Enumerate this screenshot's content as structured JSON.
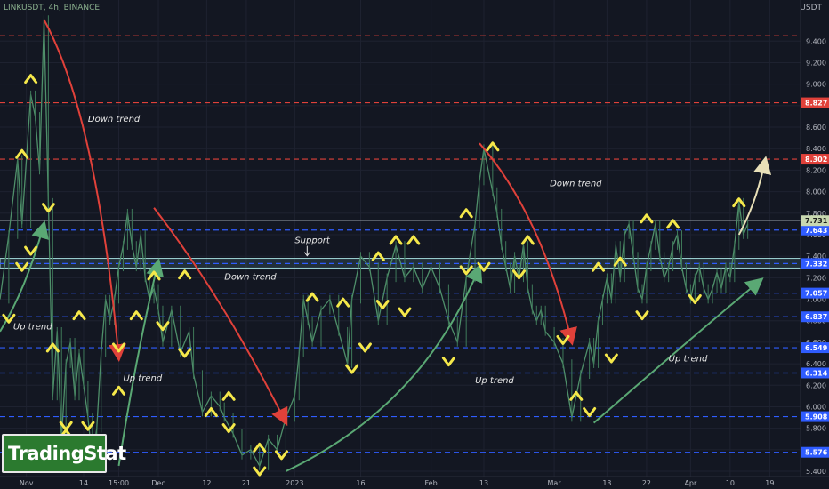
{
  "header": {
    "symbol_title": "LINKUSDT, 4h, BINANCE",
    "currency": "USDT"
  },
  "logo": {
    "text": "TradingStat"
  },
  "chart_data": {
    "type": "line",
    "title": "LINKUSDT, 4h, BINANCE",
    "ylim": [
      5.4,
      9.7
    ],
    "y_ticks": [
      9.4,
      9.2,
      9.0,
      8.8,
      8.6,
      8.4,
      8.2,
      8.0,
      7.8,
      7.6,
      7.4,
      7.2,
      7.0,
      6.8,
      6.6,
      6.4,
      6.2,
      6.0,
      5.8,
      5.6,
      5.4
    ],
    "y_tick_labels": [
      "9.400",
      "9.200",
      "9.000",
      "8.800",
      "8.600",
      "8.400",
      "8.200",
      "8.000",
      "7.800",
      "7.600",
      "7.400",
      "7.200",
      "7.000",
      "6.800",
      "6.600",
      "6.400",
      "6.200",
      "6.000",
      "5.800",
      "5.600",
      "5.400"
    ],
    "x_ticks": [
      {
        "label": "Nov",
        "day": 0
      },
      {
        "label": "14",
        "day": 13
      },
      {
        "label": "15:00",
        "day": 21
      },
      {
        "label": "Dec",
        "day": 30
      },
      {
        "label": "12",
        "day": 41
      },
      {
        "label": "21",
        "day": 50
      },
      {
        "label": "2023",
        "day": 61
      },
      {
        "label": "16",
        "day": 76
      },
      {
        "label": "Feb",
        "day": 92
      },
      {
        "label": "13",
        "day": 104
      },
      {
        "label": "Mar",
        "day": 120
      },
      {
        "label": "13",
        "day": 132
      },
      {
        "label": "22",
        "day": 141
      },
      {
        "label": "Apr",
        "day": 151
      },
      {
        "label": "10",
        "day": 160
      },
      {
        "label": "19",
        "day": 169
      }
    ],
    "xlim": [
      -6,
      176
    ],
    "price_series": {
      "name": "LINKUSDT",
      "color": "#4f8f6a",
      "days": [
        -6,
        -4,
        -2,
        -1,
        1,
        2,
        3,
        4,
        5,
        6,
        7,
        8,
        9,
        10,
        11,
        12,
        13,
        14,
        15,
        16,
        17,
        18,
        19,
        20,
        21,
        22,
        23,
        24,
        25,
        26,
        27,
        28,
        29,
        30,
        31,
        33,
        35,
        37,
        38,
        40,
        42,
        44,
        45,
        47,
        49,
        51,
        53,
        55,
        57,
        59,
        61,
        62,
        63,
        64,
        65,
        67,
        69,
        71,
        73,
        74,
        76,
        78,
        80,
        82,
        84,
        86,
        88,
        90,
        92,
        94,
        96,
        98,
        100,
        102,
        103,
        104,
        106,
        107,
        108,
        109,
        110,
        111,
        112,
        113,
        114,
        115,
        116,
        117,
        118,
        120,
        122,
        124,
        126,
        128,
        129,
        130,
        131,
        132,
        133,
        134,
        135,
        136,
        137,
        138,
        139,
        140,
        141,
        142,
        143,
        144,
        145,
        146,
        147,
        148,
        149,
        150,
        151,
        152,
        153,
        154,
        155,
        156,
        157,
        158,
        159,
        160,
        161,
        162,
        163,
        164
      ],
      "values": [
        7.0,
        7.6,
        8.3,
        7.7,
        8.9,
        8.7,
        8.2,
        9.6,
        7.9,
        6.1,
        6.7,
        5.7,
        6.4,
        6.6,
        6.1,
        6.5,
        6.2,
        5.9,
        5.5,
        5.8,
        6.5,
        7.0,
        6.8,
        7.0,
        7.3,
        7.5,
        7.8,
        7.5,
        7.3,
        7.6,
        7.2,
        7.0,
        7.1,
        6.9,
        6.6,
        6.9,
        6.5,
        6.7,
        6.3,
        5.95,
        6.1,
        6.0,
        5.9,
        5.75,
        5.55,
        5.6,
        5.45,
        5.7,
        5.6,
        5.9,
        6.1,
        6.5,
        7.0,
        6.8,
        6.6,
        6.9,
        7.0,
        6.7,
        6.4,
        7.0,
        7.4,
        7.3,
        6.8,
        7.2,
        7.5,
        7.2,
        7.3,
        7.1,
        7.3,
        7.1,
        6.8,
        6.6,
        7.2,
        7.7,
        8.1,
        8.4,
        8.0,
        7.8,
        7.5,
        7.3,
        7.1,
        7.4,
        7.2,
        7.5,
        7.1,
        6.9,
        6.8,
        6.9,
        6.7,
        6.6,
        6.4,
        5.9,
        6.3,
        6.6,
        6.4,
        6.8,
        7.0,
        7.2,
        7.0,
        7.5,
        7.2,
        7.6,
        7.7,
        7.4,
        7.1,
        7.0,
        7.3,
        7.5,
        7.7,
        7.4,
        7.2,
        7.3,
        7.5,
        7.6,
        7.3,
        7.1,
        7.0,
        7.2,
        7.3,
        7.1,
        7.0,
        7.1,
        7.25,
        7.1,
        7.3,
        7.2,
        7.5,
        7.9,
        7.6,
        7.7
      ]
    },
    "horizontal_levels": [
      {
        "value": 9.45,
        "style": "dashed",
        "color": "#e0413a",
        "label": ""
      },
      {
        "value": 8.827,
        "style": "dashed",
        "color": "#e0413a",
        "label": "8.827"
      },
      {
        "value": 8.302,
        "style": "dashed",
        "color": "#e0413a",
        "label": "8.302"
      },
      {
        "value": 7.643,
        "style": "dashed",
        "color": "#2f5cff",
        "label": "7.643"
      },
      {
        "value": 7.332,
        "style": "dashed",
        "color": "#2f5cff",
        "label": "7.332"
      },
      {
        "value": 7.057,
        "style": "dashed",
        "color": "#2f5cff",
        "label": "7.057"
      },
      {
        "value": 6.837,
        "style": "dashed",
        "color": "#2f5cff",
        "label": "6.837"
      },
      {
        "value": 6.549,
        "style": "dashed",
        "color": "#2f5cff",
        "label": "6.549"
      },
      {
        "value": 6.314,
        "style": "dashed",
        "color": "#2f5cff",
        "label": "6.314"
      },
      {
        "value": 5.908,
        "style": "dashed",
        "color": "#2f5cff",
        "label": "5.908"
      },
      {
        "value": 5.576,
        "style": "dashed",
        "color": "#2f5cff",
        "label": "5.576"
      }
    ],
    "current_price": {
      "value": 7.73,
      "label": "7.731"
    },
    "support_zone": {
      "top": 7.38,
      "bottom": 7.29
    },
    "annotations": [
      {
        "text": "Down trend",
        "day": 14,
        "value": 8.65
      },
      {
        "text": "Support",
        "day": 61,
        "value": 7.52
      },
      {
        "text": "Down trend",
        "day": 45,
        "value": 7.18
      },
      {
        "text": "Up trend",
        "day": -3,
        "value": 6.72
      },
      {
        "text": "Up trend",
        "day": 22,
        "value": 6.24
      },
      {
        "text": "Down trend",
        "day": 119,
        "value": 8.05
      },
      {
        "text": "Up trend",
        "day": 146,
        "value": 6.42
      },
      {
        "text": "Up trend",
        "day": 102,
        "value": 6.22
      }
    ],
    "trend_arrows": [
      {
        "color": "#e0413a",
        "points": [
          [
            4,
            9.6
          ],
          [
            16,
            8.7
          ],
          [
            21,
            6.45
          ]
        ]
      },
      {
        "color": "#e0413a",
        "points": [
          [
            29,
            7.85
          ],
          [
            45,
            7.0
          ],
          [
            59,
            5.85
          ]
        ]
      },
      {
        "color": "#e0413a",
        "points": [
          [
            103,
            8.45
          ],
          [
            117,
            7.8
          ],
          [
            124,
            6.6
          ]
        ]
      },
      {
        "color": "#5aa874",
        "points": [
          [
            -6,
            6.7
          ],
          [
            0,
            7.1
          ],
          [
            4,
            7.7
          ]
        ]
      },
      {
        "color": "#5aa874",
        "points": [
          [
            21,
            5.45
          ],
          [
            25,
            6.5
          ],
          [
            30,
            7.35
          ]
        ]
      },
      {
        "color": "#5aa874",
        "points": [
          [
            59,
            5.4
          ],
          [
            90,
            6.0
          ],
          [
            103,
            7.3
          ]
        ]
      },
      {
        "color": "#5aa874",
        "points": [
          [
            129,
            5.85
          ],
          [
            150,
            6.6
          ],
          [
            167,
            7.18
          ]
        ]
      },
      {
        "color": "#e8e0b8",
        "points": [
          [
            162,
            7.6
          ],
          [
            166,
            7.9
          ],
          [
            168,
            8.3
          ]
        ]
      }
    ],
    "up_markers": [
      [
        -1,
        8.35
      ],
      [
        1,
        9.05
      ],
      [
        6,
        6.55
      ],
      [
        9,
        5.75
      ],
      [
        12,
        6.85
      ],
      [
        21,
        6.15
      ],
      [
        25,
        6.85
      ],
      [
        29,
        7.22
      ],
      [
        36,
        7.23
      ],
      [
        42,
        5.95
      ],
      [
        46,
        6.1
      ],
      [
        53,
        5.62
      ],
      [
        65,
        7.02
      ],
      [
        72,
        6.97
      ],
      [
        80,
        7.4
      ],
      [
        84,
        7.55
      ],
      [
        88,
        7.55
      ],
      [
        100,
        7.8
      ],
      [
        106,
        8.42
      ],
      [
        114,
        7.55
      ],
      [
        125,
        6.1
      ],
      [
        130,
        7.3
      ],
      [
        135,
        7.35
      ],
      [
        141,
        7.75
      ],
      [
        147,
        7.7
      ],
      [
        162,
        7.9
      ]
    ],
    "down_markers": [
      [
        -4,
        6.82
      ],
      [
        1,
        7.45
      ],
      [
        5,
        7.85
      ],
      [
        -1,
        7.3
      ],
      [
        9,
        5.82
      ],
      [
        14,
        5.82
      ],
      [
        21,
        6.55
      ],
      [
        31,
        6.75
      ],
      [
        36,
        6.5
      ],
      [
        46,
        5.8
      ],
      [
        53,
        5.4
      ],
      [
        58,
        5.55
      ],
      [
        74,
        6.35
      ],
      [
        77,
        6.55
      ],
      [
        81,
        6.95
      ],
      [
        86,
        6.88
      ],
      [
        96,
        6.42
      ],
      [
        100,
        7.27
      ],
      [
        104,
        7.3
      ],
      [
        112,
        7.23
      ],
      [
        122,
        6.62
      ],
      [
        128,
        5.95
      ],
      [
        133,
        6.45
      ],
      [
        140,
        6.85
      ],
      [
        152,
        7.0
      ]
    ],
    "grid": true,
    "legend": "none"
  }
}
